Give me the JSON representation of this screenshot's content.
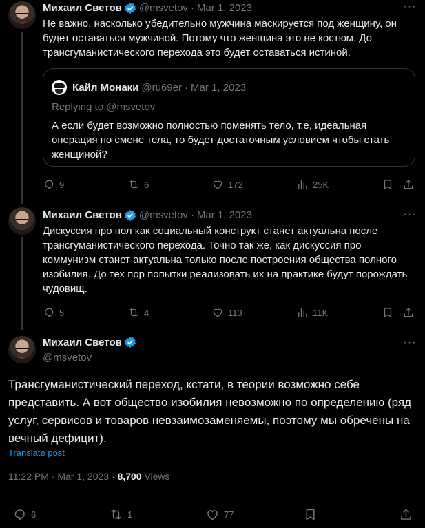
{
  "posts": [
    {
      "name": "Михаил Светов",
      "handle": "@msvetov",
      "date": "Mar 1, 2023",
      "text": "Не важно, насколько убедительно мужчина маскируется под женщину, он будет оставаться мужчиной. Потому что женщина это не костюм. До трансгуманистического перехода это будет оставаться истиной.",
      "quote": {
        "name": "Кайл Монаки",
        "handle": "@ru69er",
        "date": "Mar 1, 2023",
        "replying_to": "Replying to @msvetov",
        "text": "А если будет возможно полностью поменять тело, т.е, идеальная операция по смене тела, то будет достаточным условием чтобы стать женщиной?"
      },
      "replies": "9",
      "reposts": "6",
      "likes": "172",
      "views": "25K"
    },
    {
      "name": "Михаил Светов",
      "handle": "@msvetov",
      "date": "Mar 1, 2023",
      "text": "Дискуссия про пол как социальный конструкт станет актуальна после трансгуманистического перехода. Точно так же, как дискуссия про коммунизм станет актуальна только после построения общества полного изобилия. До тех пор попытки реализовать их на практике будут порождать чудовищ.",
      "replies": "5",
      "reposts": "4",
      "likes": "113",
      "views": "11K"
    }
  ],
  "main_post": {
    "name": "Михаил Светов",
    "handle": "@msvetov",
    "text": "Трансгуманистический переход, кстати, в теории возможно себе представить. А вот общество изобилия невозможно по определению (ряд услуг, сервисов и товаров невзаимозаменяемы, поэтому мы обречены на вечный дефицит).",
    "translate": "Translate post",
    "time": "11:22 PM",
    "date": "Mar 1, 2023",
    "views_count": "8,700",
    "views_label": "Views",
    "replies": "6",
    "reposts": "1",
    "likes": "77"
  },
  "separator": "·",
  "icons": [
    "verified-badge-icon",
    "more-icon",
    "reply-icon",
    "repost-icon",
    "like-icon",
    "views-icon",
    "bookmark-icon",
    "share-icon"
  ],
  "colors": {
    "background": "#000000",
    "text": "#e7e9ea",
    "muted": "#71767b",
    "accent": "#1d9bf0",
    "border": "#2f3336"
  }
}
